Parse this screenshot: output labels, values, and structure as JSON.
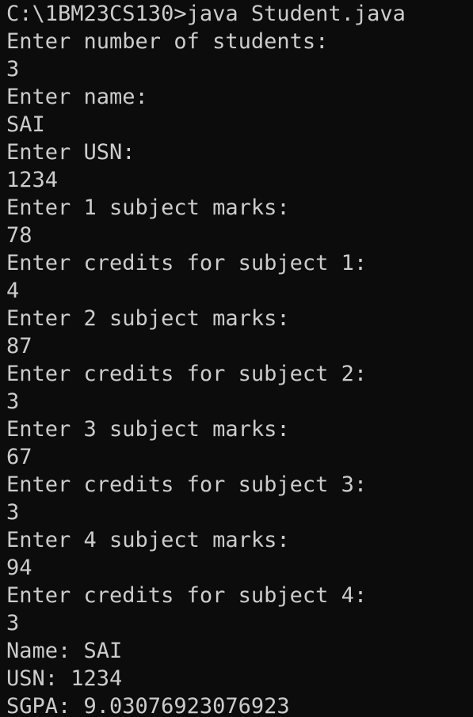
{
  "terminal": {
    "lines": [
      "C:\\1BM23CS130>java Student.java",
      "Enter number of students:",
      "3",
      "Enter name:",
      "SAI",
      "Enter USN:",
      "1234",
      "Enter 1 subject marks:",
      "78",
      "Enter credits for subject 1:",
      "4",
      "Enter 2 subject marks:",
      "87",
      "Enter credits for subject 2:",
      "3",
      "Enter 3 subject marks:",
      "67",
      "Enter credits for subject 3:",
      "3",
      "Enter 4 subject marks:",
      "94",
      "Enter credits for subject 4:",
      "3",
      "Name: SAI",
      "USN: 1234",
      "SGPA: 9.03076923076923"
    ],
    "colors": {
      "background": "#0c0c0c",
      "text": "#cccccc"
    }
  }
}
